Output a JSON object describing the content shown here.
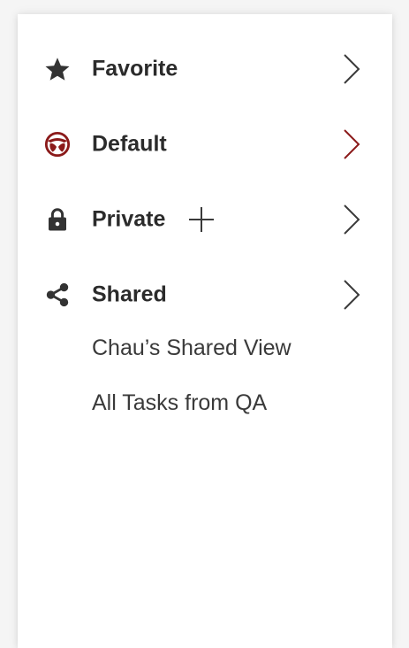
{
  "sections": {
    "favorite": {
      "label": "Favorite",
      "icon": "star-icon"
    },
    "default": {
      "label": "Default",
      "icon": "default-logo-icon",
      "accent": "#8b1a1a"
    },
    "private": {
      "label": "Private",
      "icon": "lock-icon",
      "add_icon": "plus-icon"
    },
    "shared": {
      "label": "Shared",
      "icon": "share-icon",
      "items": [
        "Chau’s Shared View",
        "All Tasks from QA"
      ]
    }
  },
  "colors": {
    "text": "#2b2b2b",
    "icon": "#333333",
    "chevron": "#3a3a3a",
    "accent": "#8b1a1a"
  }
}
